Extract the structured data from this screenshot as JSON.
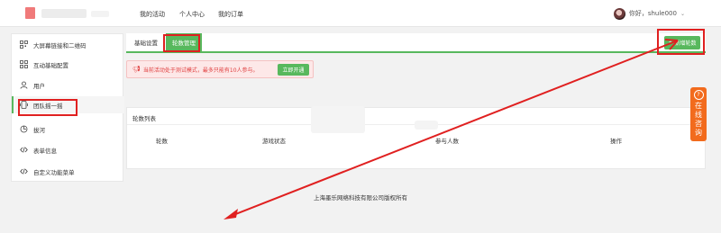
{
  "header": {
    "nav": [
      "我的活动",
      "个人中心",
      "我的订单"
    ],
    "user_label": "你好，shule000"
  },
  "sidebar": {
    "items": [
      {
        "label": "大屏幕链接和二维码",
        "icon": "qrcode-icon"
      },
      {
        "label": "互动基础配置",
        "icon": "grid-icon"
      },
      {
        "label": "用户",
        "icon": "user-icon"
      },
      {
        "label": "团队摇一摇",
        "icon": "shake-icon",
        "active": true
      },
      {
        "label": "拔河",
        "icon": "tug-icon"
      },
      {
        "label": "表单信息",
        "icon": "code-icon"
      },
      {
        "label": "自定义功能菜单",
        "icon": "code-icon"
      }
    ]
  },
  "tabs": [
    "基础设置",
    "轮数管理"
  ],
  "add_button": "新增轮数",
  "alert": {
    "text": "当前活动处于测试模式，最多只能有10人参与。",
    "button": "立即开通"
  },
  "table": {
    "title": "轮数列表",
    "columns": [
      "轮数",
      "游戏状态",
      "参与人数",
      "操作"
    ]
  },
  "footer": "上海墨乐网络科技有限公司版权所有",
  "consult": {
    "text": "在线咨询"
  },
  "colors": {
    "accent": "#58b85d",
    "alert": "#e04040",
    "consult": "#f26b1d",
    "annotation": "#e02020"
  }
}
